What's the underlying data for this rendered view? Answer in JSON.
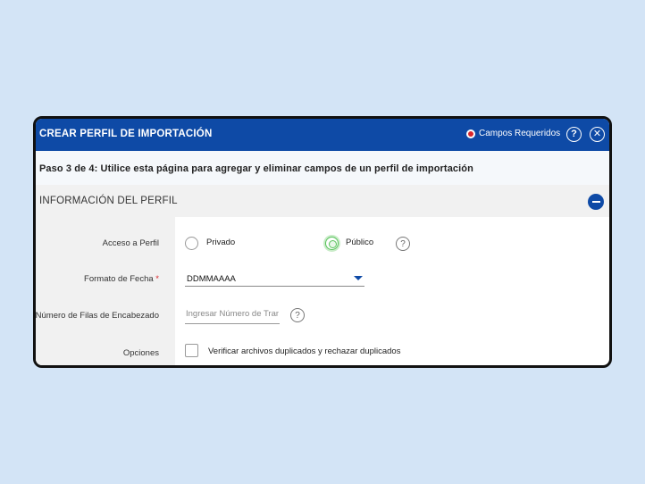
{
  "header": {
    "title": "CREAR PERFIL DE IMPORTACIÓN",
    "required_label": "Campos Requeridos",
    "help_icon": "question-icon",
    "close_icon": "close-icon",
    "help_glyph": "?",
    "close_glyph": "✕"
  },
  "step": {
    "text": "Paso 3 de 4:  Utilice esta página para agregar y eliminar campos de un perfil de importación"
  },
  "section": {
    "title": "INFORMACIÓN DEL PERFIL",
    "collapse_icon": "minus-icon"
  },
  "form": {
    "access": {
      "label": "Acceso a Perfil",
      "options": [
        {
          "label": "Privado",
          "selected": false
        },
        {
          "label": "Público",
          "selected": true
        }
      ],
      "help_glyph": "?"
    },
    "date_format": {
      "label": "Formato de Fecha",
      "required_mark": "*",
      "value": "DDMMAAAA"
    },
    "header_rows": {
      "label": "Número de Filas de Encabezado",
      "placeholder": "Ingresar Número de Transacciones",
      "help_glyph": "?"
    },
    "options": {
      "label": "Opciones",
      "checkbox_label": "Verificar archivos duplicados y rechazar duplicados",
      "checked": false
    }
  },
  "colors": {
    "brand_blue": "#0e4aa6",
    "required_red": "#d9262c",
    "selected_green": "#57c25a",
    "background": "#d3e4f6"
  }
}
